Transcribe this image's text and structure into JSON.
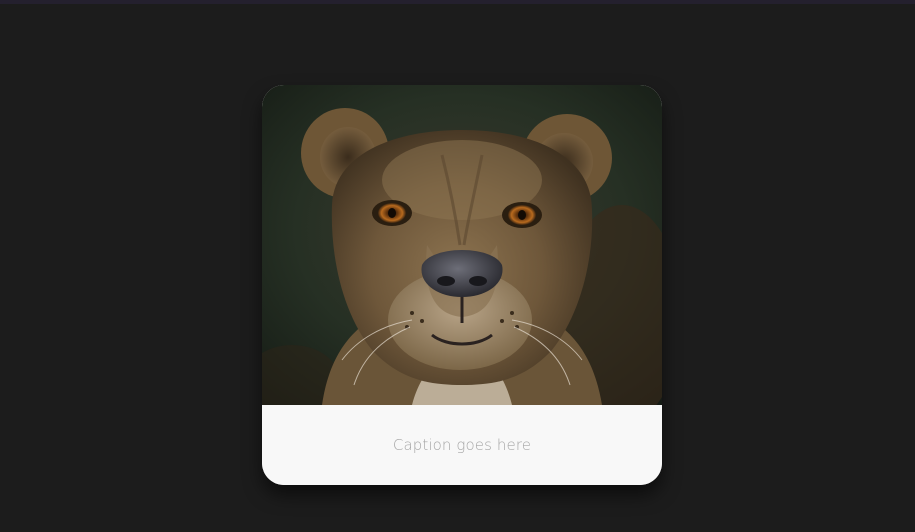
{
  "card": {
    "image_alt": "Lioness portrait",
    "caption": "Caption goes here"
  },
  "colors": {
    "background": "#1c1c1c",
    "card_bg": "#f8f8f8",
    "caption_text": "#a6a6a6"
  }
}
